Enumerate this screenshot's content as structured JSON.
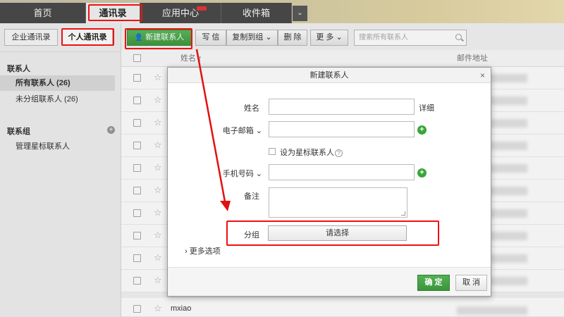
{
  "top_tabs": {
    "home": "首页",
    "contacts": "通讯录",
    "apps": "应用中心",
    "inbox": "收件箱",
    "more_icon": "chevron-down-icon"
  },
  "left_panel": {
    "enterprise_btn": "企业通讯录",
    "personal_btn": "个人通讯录",
    "section_contacts": "联系人",
    "all_contacts": "所有联系人 (26)",
    "ungrouped": "未分组联系人 (26)",
    "section_groups": "联系组",
    "add_group_icon": "plus-circle-icon",
    "manage_starred": "管理星标联系人"
  },
  "toolbar": {
    "new_contact": "新建联系人",
    "new_contact_icon": "add-user-icon",
    "write": "写 信",
    "copy_to_group": "复制到组",
    "delete": "删 除",
    "more": "更 多",
    "search_placeholder": "搜索所有联系人"
  },
  "list": {
    "col_name": "姓名 ↑",
    "col_email": "邮件地址",
    "last_name": "mxiao"
  },
  "dialog": {
    "title": "新建联系人",
    "close": "×",
    "name_label": "姓名",
    "detail_link": "详细",
    "email_label": "电子邮箱 ⌄",
    "star_label": "设为星标联系人",
    "help_icon": "?",
    "phone_label": "手机号码 ⌄",
    "remark_label": "备注",
    "group_label": "分组",
    "group_select": "请选择",
    "more_options": "› 更多选项",
    "confirm": "确 定",
    "cancel": "取 消"
  },
  "colors": {
    "annotation_red": "#e11111",
    "primary_green": "#3f9a3f"
  }
}
